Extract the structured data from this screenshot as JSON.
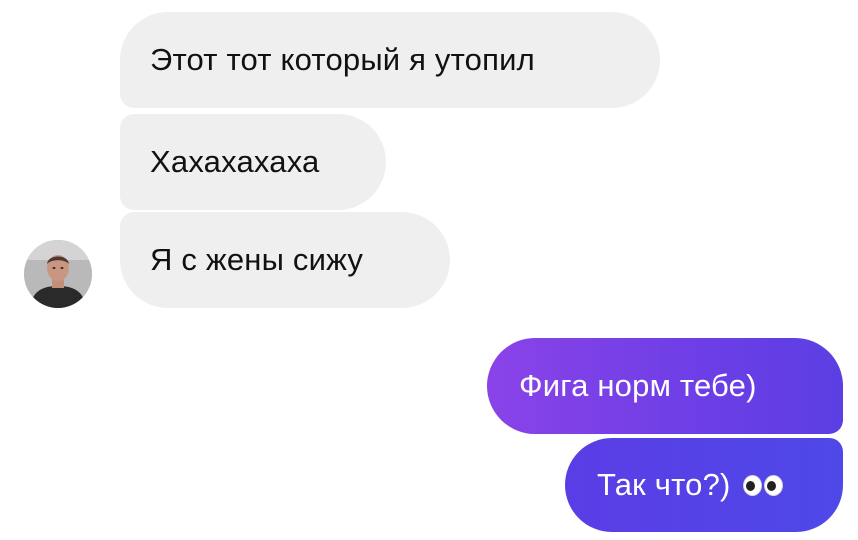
{
  "messages": {
    "incoming": [
      "Этот тот который я утопил",
      "Хахахахаха",
      "Я с жены сижу"
    ],
    "outgoing": [
      "Фига норм тебе)",
      "Так что?)"
    ]
  },
  "avatar": {
    "icon": "person-photo"
  },
  "emoji": {
    "name": "eyes-emoji"
  },
  "colors": {
    "incoming_bubble": "#efefef",
    "outgoing_start": "#8a43e8",
    "outgoing_end": "#4f48e8",
    "background": "#ffffff"
  }
}
